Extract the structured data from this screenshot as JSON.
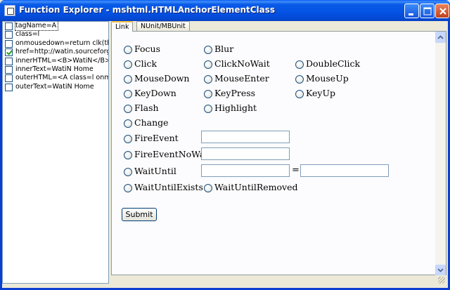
{
  "window": {
    "title": "Function Explorer - mshtml.HTMLAnchorElementClass"
  },
  "properties": [
    {
      "text": "tagName=A",
      "checked": false
    },
    {
      "text": "class=l",
      "checked": false
    },
    {
      "text": "onmousedown=return clk(this.hre",
      "checked": false
    },
    {
      "text": "href=http://watin.sourceforge.ne",
      "checked": true
    },
    {
      "text": "innerHTML=<B>WatiN</B> Hom",
      "checked": false
    },
    {
      "text": "innerText=WatiN Home",
      "checked": false
    },
    {
      "text": "outerHTML=<A class=l onmouse",
      "checked": false
    },
    {
      "text": "outerText=WatiN Home",
      "checked": false
    }
  ],
  "tabs": [
    {
      "label": "Link"
    },
    {
      "label": "NUnit/MBUnit"
    }
  ],
  "options": {
    "focus": "Focus",
    "blur": "Blur",
    "click": "Click",
    "clicknowait": "ClickNoWait",
    "doubleclick": "DoubleClick",
    "mousedown": "MouseDown",
    "mouseenter": "MouseEnter",
    "mouseup": "MouseUp",
    "keydown": "KeyDown",
    "keypress": "KeyPress",
    "keyup": "KeyUp",
    "flash": "Flash",
    "highlight": "Highlight",
    "change": "Change",
    "fireevent": "FireEvent",
    "fireeventnowait": "FireEventNoWait",
    "waituntil": "WaitUntil",
    "waituntilexists": "WaitUntilExists",
    "waituntilremoved": "WaitUntilRemoved"
  },
  "fields": {
    "fireevent": "",
    "fireeventnowait": "",
    "waituntil_name": "",
    "waituntil_value": "",
    "equals": "="
  },
  "submit_label": "Submit"
}
